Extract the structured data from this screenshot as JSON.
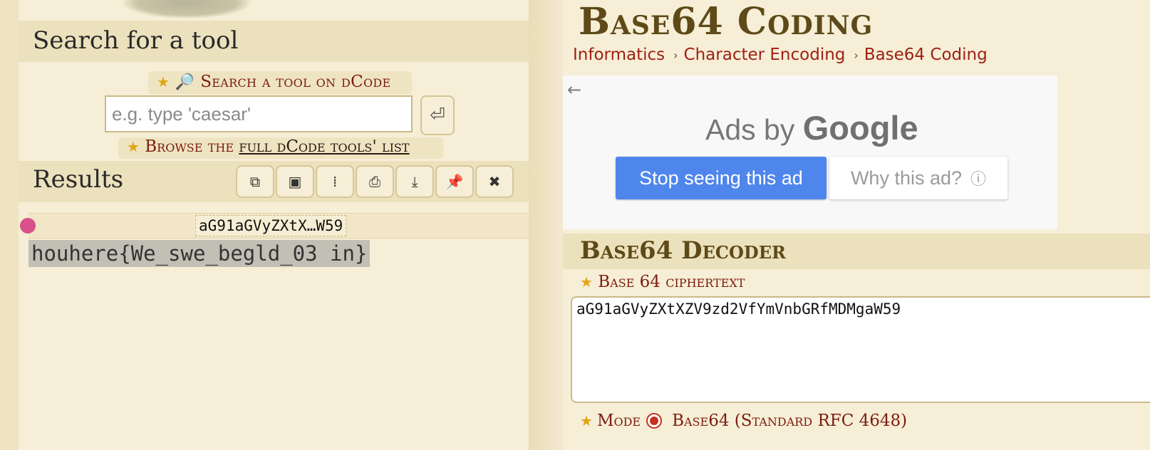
{
  "sidebar": {
    "search_section_title": "Search for a tool",
    "search_link_label": "Search a tool on dCode",
    "search_placeholder": "e.g. type 'caesar'",
    "enter_glyph": "⏎",
    "browse_prefix": "Browse the ",
    "browse_link_label": "full dCode tools' list",
    "results_title": "Results",
    "result_tools": [
      {
        "name": "copy-icon",
        "glyph": "⧉"
      },
      {
        "name": "notepad-icon",
        "glyph": "▣"
      },
      {
        "name": "columns-icon",
        "glyph": "⁞"
      },
      {
        "name": "print-icon",
        "glyph": "⎙"
      },
      {
        "name": "download-icon",
        "glyph": "⤓"
      },
      {
        "name": "pin-icon",
        "glyph": "📌"
      },
      {
        "name": "close-icon",
        "glyph": "✖"
      }
    ],
    "result_key": "aG91aGVyZXtX…W59",
    "result_value": "houhere{We_swe_begld_03 in}"
  },
  "main": {
    "page_title": "Base64 Coding",
    "breadcrumb": [
      "Informatics",
      "Character Encoding",
      "Base64 Coding"
    ],
    "breadcrumb_separator": "›",
    "ad": {
      "back_glyph": "←",
      "ads_by": "Ads by ",
      "google": "Google",
      "stop_label": "Stop seeing this ad",
      "why_label": "Why this ad?",
      "info_glyph": "ⓘ"
    },
    "decoder": {
      "title": "Base64 Decoder",
      "ciphertext_label": "Base 64 ciphertext",
      "ciphertext_value": "aG91aGVyZXtXZV9zd2VfYmVnbGRfMDMgaW59",
      "mode_label": "Mode",
      "mode_selected": "Base64 (Standard RFC 4648)"
    }
  },
  "colors": {
    "accent_red": "#9e1f12",
    "title_brown": "#5e4a18",
    "ad_blue": "#4f86ec",
    "result_dot": "#d9508a"
  }
}
